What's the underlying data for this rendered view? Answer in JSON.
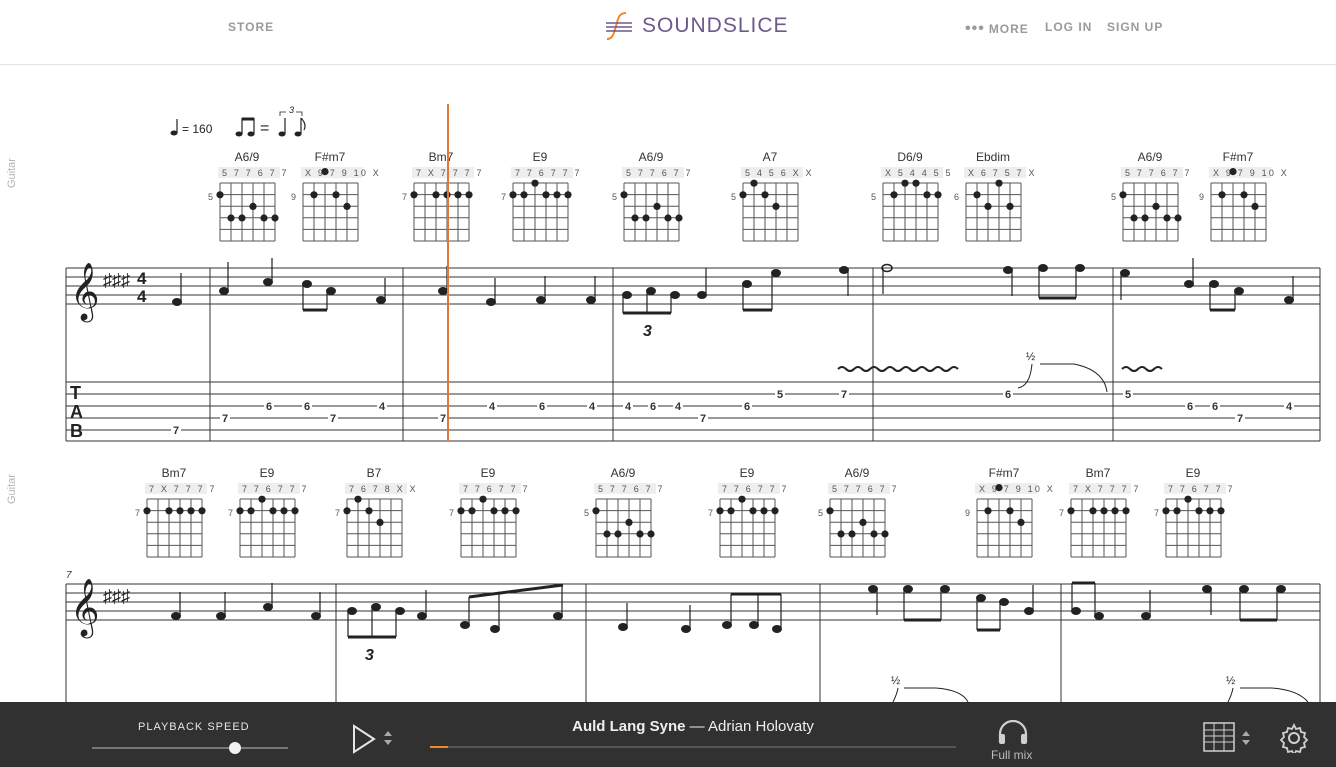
{
  "nav": {
    "store": "STORE",
    "logo_text": "SOUNDSLICE",
    "more": "MORE",
    "login": "LOG IN",
    "signup": "SIGN UP"
  },
  "side_labels": [
    "Guitar",
    "Guitar"
  ],
  "score": {
    "tempo": "= 160",
    "swing_equals": "=",
    "triplet_mark": "3",
    "tab_letters": [
      "T",
      "A",
      "B"
    ],
    "measure_number": "7",
    "system1_chords": [
      {
        "name": "A6/9",
        "frets": "5 7 7 6 7 7",
        "pos": "5"
      },
      {
        "name": "F#m7",
        "frets": "X 9 7 9 10 X",
        "pos": "9"
      },
      {
        "name": "Bm7",
        "frets": "7 X 7 7 7 7",
        "pos": "7"
      },
      {
        "name": "E9",
        "frets": "7 7 6 7 7 7",
        "pos": "7"
      },
      {
        "name": "A6/9",
        "frets": "5 7 7 6 7 7",
        "pos": "5"
      },
      {
        "name": "A7",
        "frets": "5 4 5 6 X X",
        "pos": "5"
      },
      {
        "name": "D6/9",
        "frets": "X 5 4 4 5 5",
        "pos": "5"
      },
      {
        "name": "Ebdim",
        "frets": "X 6 7 5 7 X",
        "pos": "6"
      },
      {
        "name": "A6/9",
        "frets": "5 7 7 6 7 7",
        "pos": "5"
      },
      {
        "name": "F#m7",
        "frets": "X 9 7 9 10 X",
        "pos": "9"
      }
    ],
    "system2_chords": [
      {
        "name": "Bm7",
        "frets": "7 X 7 7 7 7",
        "pos": "7"
      },
      {
        "name": "E9",
        "frets": "7 7 6 7 7 7",
        "pos": "7"
      },
      {
        "name": "B7",
        "frets": "7 6 7 8 X X",
        "pos": "7"
      },
      {
        "name": "E9",
        "frets": "7 7 6 7 7 7",
        "pos": "7"
      },
      {
        "name": "A6/9",
        "frets": "5 7 7 6 7 7",
        "pos": "5"
      },
      {
        "name": "E9",
        "frets": "7 7 6 7 7 7",
        "pos": "7"
      },
      {
        "name": "A6/9",
        "frets": "5 7 7 6 7 7",
        "pos": "5"
      },
      {
        "name": "F#m7",
        "frets": "X 9 7 9 10 X",
        "pos": "9"
      },
      {
        "name": "Bm7",
        "frets": "7 X 7 7 7 7",
        "pos": "7"
      },
      {
        "name": "E9",
        "frets": "7 7 6 7 7 7",
        "pos": "7"
      }
    ],
    "tab_numbers": [
      "7",
      "7",
      "6",
      "6",
      "7",
      "4",
      "7",
      "4",
      "6",
      "4",
      "4",
      "6",
      "4",
      "7",
      "6",
      "5",
      "7",
      "6",
      "5",
      "6",
      "6",
      "7",
      "4"
    ],
    "bend_label": "½",
    "triplet_number": "3"
  },
  "player": {
    "speed_label": "PLAYBACK SPEED",
    "speed_value": 0.73,
    "song_title": "Auld Lang Syne",
    "separator": " — ",
    "artist": "Adrian Holovaty",
    "progress": 0.035,
    "mix_label": "Full mix",
    "accent_color": "#f08a24"
  }
}
